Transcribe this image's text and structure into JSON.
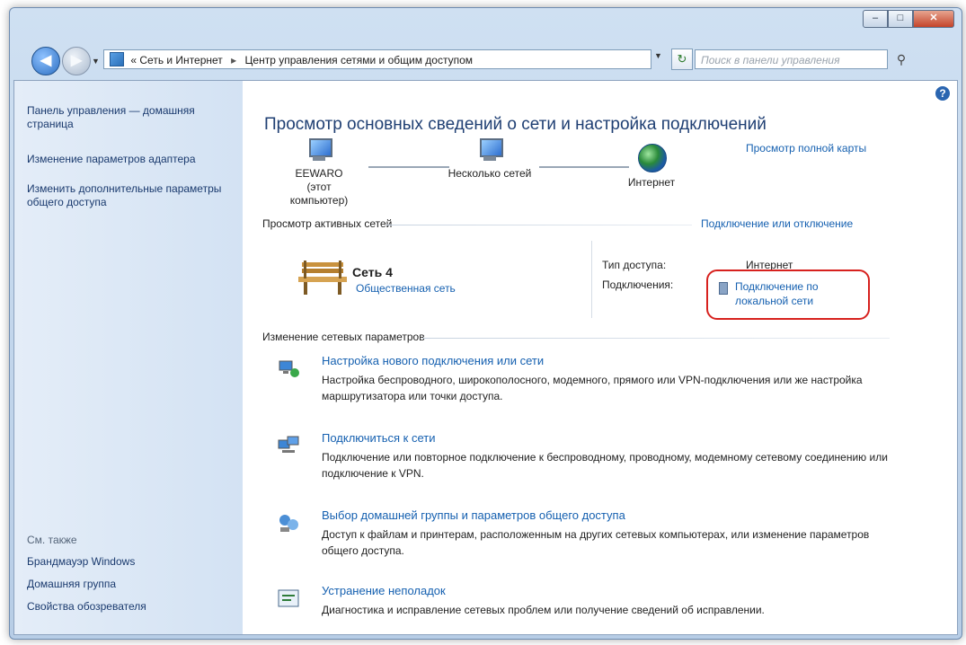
{
  "window": {
    "btn_min": "–",
    "btn_max": "□",
    "btn_close": "✕"
  },
  "address_bar": {
    "back_icon": "back-arrow-icon",
    "forward_icon": "forward-arrow-icon",
    "chevron": "«",
    "crumb1": "Сеть и Интернет",
    "crumb_sep": "▸",
    "crumb2": "Центр управления сетями и общим доступом",
    "search_placeholder": "Поиск в панели управления"
  },
  "sidebar": {
    "links": [
      "Панель управления — домашняя страница",
      "Изменение параметров адаптера",
      "Изменить дополнительные параметры общего доступа"
    ],
    "see_also_title": "См. также",
    "see_also": [
      "Брандмауэр Windows",
      "Домашняя группа",
      "Свойства обозревателя"
    ]
  },
  "main": {
    "title": "Просмотр основных сведений о сети и настройка подключений",
    "full_map_link": "Просмотр полной карты",
    "map": {
      "computer_name": "EEWARO",
      "computer_sub": "(этот компьютер)",
      "networks": "Несколько сетей",
      "internet": "Интернет"
    },
    "active_header": "Просмотр активных сетей",
    "connect_link": "Подключение или отключение",
    "network": {
      "name": "Сеть 4",
      "type": "Общественная сеть",
      "access_label": "Тип доступа:",
      "access_value": "Интернет",
      "conn_label": "Подключения:",
      "conn_value": "Подключение по локальной сети"
    },
    "change_header": "Изменение сетевых параметров",
    "tasks": [
      {
        "title": "Настройка нового подключения или сети",
        "desc": "Настройка беспроводного, широкополосного, модемного, прямого или VPN-подключения или же настройка маршрутизатора или точки доступа."
      },
      {
        "title": "Подключиться к сети",
        "desc": "Подключение или повторное подключение к беспроводному, проводному, модемному сетевому соединению или подключение к VPN."
      },
      {
        "title": "Выбор домашней группы и параметров общего доступа",
        "desc": "Доступ к файлам и принтерам, расположенным на других сетевых компьютерах, или изменение параметров общего доступа."
      },
      {
        "title": "Устранение неполадок",
        "desc": "Диагностика и исправление сетевых проблем или получение сведений об исправлении."
      }
    ]
  },
  "colors": {
    "link": "#1560b0",
    "title": "#1f3f73",
    "highlight": "#d7211e"
  }
}
